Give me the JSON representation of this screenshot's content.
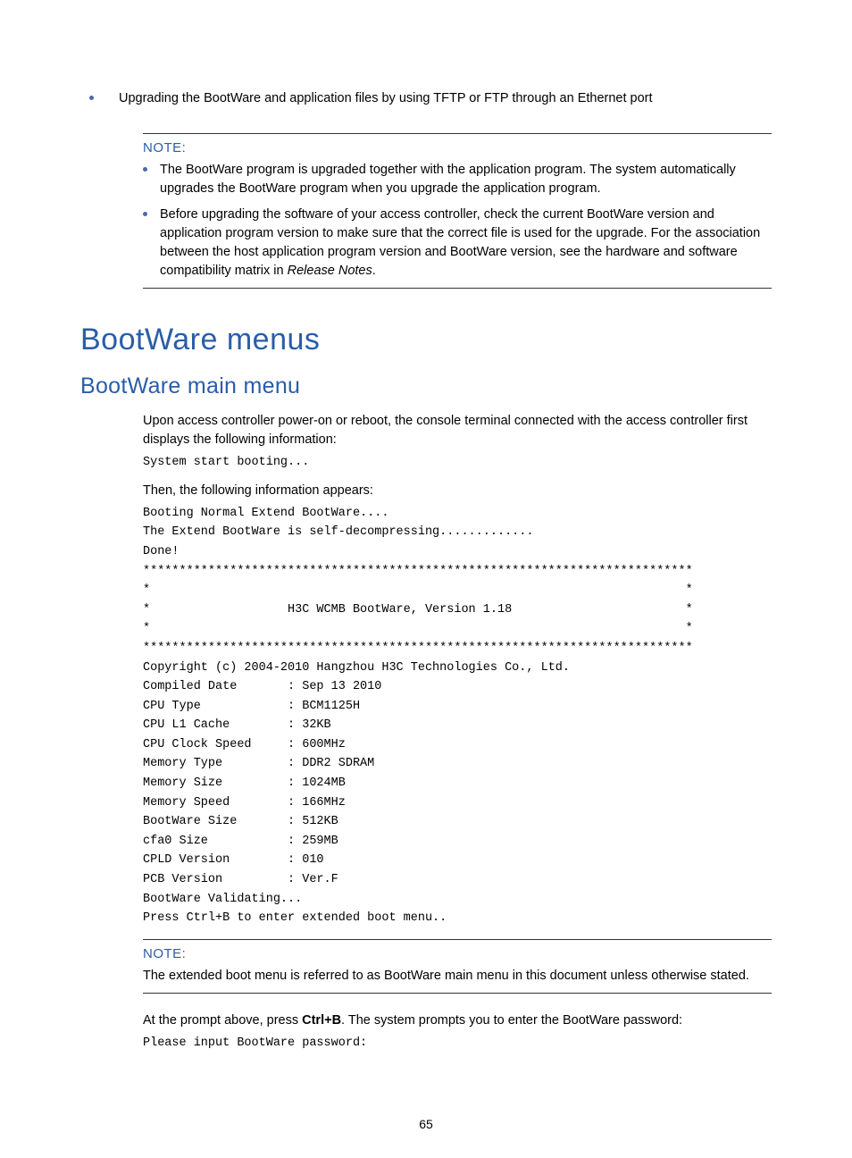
{
  "top_bullet": "Upgrading the BootWare and application files by using TFTP or FTP through an Ethernet port",
  "note1": {
    "title": "NOTE:",
    "items": [
      "The BootWare program is upgraded together with the application program. The system automatically upgrades the BootWare program when you upgrade the application program.",
      "Before upgrading the software of your access controller, check the current BootWare version and application program version to make sure that the correct file is used for the upgrade. For the association between the host application program version and BootWare version, see the hardware and software compatibility matrix in "
    ],
    "release_notes": "Release Notes",
    "period": "."
  },
  "h1": "BootWare menus",
  "h2": "BootWare main menu",
  "para1": "Upon access controller power-on or reboot, the console terminal connected with the access controller first displays the following information:",
  "code1": "System start booting...",
  "para2": "Then, the following information appears:",
  "code2": "Booting Normal Extend BootWare....\nThe Extend BootWare is self-decompressing.............\nDone!\n****************************************************************************\n*                                                                          *\n*                   H3C WCMB BootWare, Version 1.18                        *\n*                                                                          *\n****************************************************************************\nCopyright (c) 2004-2010 Hangzhou H3C Technologies Co., Ltd.\nCompiled Date       : Sep 13 2010\nCPU Type            : BCM1125H\nCPU L1 Cache        : 32KB\nCPU Clock Speed     : 600MHz\nMemory Type         : DDR2 SDRAM\nMemory Size         : 1024MB\nMemory Speed        : 166MHz\nBootWare Size       : 512KB\ncfa0 Size           : 259MB\nCPLD Version        : 010\nPCB Version         : Ver.F\nBootWare Validating...\nPress Ctrl+B to enter extended boot menu..",
  "note2": {
    "title": "NOTE:",
    "body": "The extended boot menu is referred to as BootWare main menu in this document unless otherwise stated."
  },
  "para3_pre": "At the prompt above, press ",
  "para3_key": "Ctrl+B",
  "para3_post": ". The system prompts you to enter the BootWare password:",
  "code3": "Please input BootWare password:",
  "page_number": "65"
}
